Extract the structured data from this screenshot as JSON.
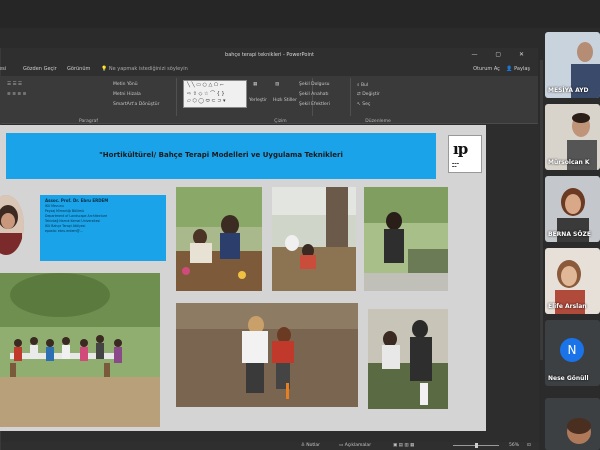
{
  "window": {
    "title": "bahçe terapi teknikleri - PowerPoint",
    "controls": "—  ▢  ✕"
  },
  "menu": {
    "items": [
      "esi",
      "Gözden Geçir",
      "Görünüm"
    ],
    "tell_me": "Ne yapmak istediğinizi söyleyin",
    "account": "Oturum Aç",
    "share": "Paylaş"
  },
  "ribbon": {
    "paragraph_label": "Paragraf",
    "drawing_label": "Çizim",
    "editing_label": "Düzenleme",
    "text_direction": "Metin Yönü",
    "align_text": "Metni Hizala",
    "smartart": "SmartArt'a Dönüştür",
    "arrange": "Yerleştir",
    "quick_styles": "Hızlı Stiller",
    "shape_fill": "Şekil Dolgusu",
    "shape_outline": "Şekil Anahatı",
    "shape_effects": "Şekil Efektleri",
    "find": "Bul",
    "replace": "Değiştir",
    "select": "Seç"
  },
  "slide": {
    "title": "\"Hortikültürel/ Bahçe Terapi Modelleri ve Uygulama Teknikleri",
    "speaker_lines": [
      "Assoc. Prof. Dr. Ebru ERDEM",
      "İKÜ Mezunu",
      "Peyzaj Mimarlığı Bölümü",
      "Department of Landscape Architecture",
      "Tekirdağ Namık Kemal Üniversitesi",
      "İKÜ Bahçe Terapi Atölyesi",
      "eposta: ebru.erdem@..."
    ]
  },
  "status": {
    "notes": "Notlar",
    "comments": "Açıklamalar",
    "zoom": "56%"
  },
  "participants": [
    {
      "name": "MESİYA AYD"
    },
    {
      "name": "Mürsolcan K"
    },
    {
      "name": "BERNA SÖZE"
    },
    {
      "name": "Elife Arslan"
    },
    {
      "name": "Nese Gönüll",
      "initial": "N"
    },
    {
      "name": ""
    }
  ],
  "colors": {
    "title_bar": "#1aa3e8",
    "slide_bg": "#d4d4d4",
    "avatar_blue": "#1a73e8"
  }
}
